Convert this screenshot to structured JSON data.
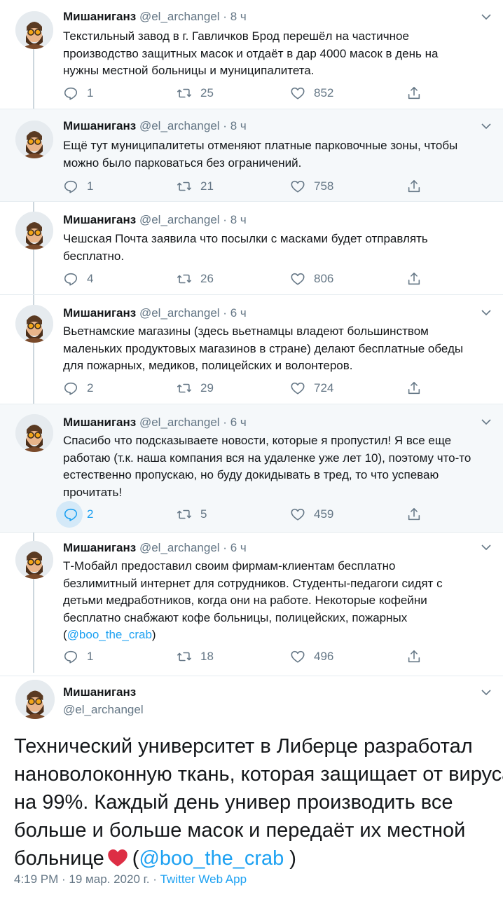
{
  "author": {
    "name": "Мишаниганз",
    "handle": "@el_archangel",
    "sep": "·"
  },
  "tweets": [
    {
      "time": "8 ч",
      "lines": [
        "Текстильный завод в г. Гавличков Брод перешёл на частичное",
        "производство защитных масок и отдаёт в дар 4000 масок в день на",
        "нужны местной больницы и муниципалитета."
      ],
      "replies": "1",
      "retweets": "25",
      "likes": "852"
    },
    {
      "time": "8 ч",
      "lines": [
        "Ещё тут муниципалитеты отменяют платные парковочные зоны, чтобы",
        "можно было парковаться без ограничений."
      ],
      "replies": "1",
      "retweets": "21",
      "likes": "758"
    },
    {
      "time": "8 ч",
      "lines": [
        "Чешская Почта заявила что посылки с масками будет отправлять",
        "бесплатно."
      ],
      "replies": "4",
      "retweets": "26",
      "likes": "806"
    },
    {
      "time": "6 ч",
      "lines": [
        "Вьетнамские магазины (здесь вьетнамцы владеют большинством",
        "маленьких продуктовых магазинов в стране) делают бесплатные обеды",
        "для пожарных, медиков, полицейских и волонтеров."
      ],
      "replies": "2",
      "retweets": "29",
      "likes": "724"
    },
    {
      "time": "6 ч",
      "lines": [
        "Спасибо что подсказываете новости, которые я пропустил!  Я все еще",
        "работаю (т.к. наша компания вся на удаленке уже лет 10), поэтому что-то",
        "естественно пропускаю, но буду докидывать в тред, то что успеваю",
        "прочитать!"
      ],
      "replies": "2",
      "retweets": "5",
      "likes": "459"
    },
    {
      "time": "6 ч",
      "lines": [
        "Т-Мобайл предоставил своим фирмам-клиентам бесплатно",
        "безлимитный интернет для сотрудников. Студенты-педагоги сидят с",
        "детьми медработников, когда они на работе. Некоторые кофейни",
        "бесплатно снабжают кофе больницы, полицейских, пожарных"
      ],
      "mention_line": {
        "open": "(",
        "mention": "@boo_the_crab",
        "close": ")"
      },
      "replies": "1",
      "retweets": "18",
      "likes": "496"
    }
  ],
  "main_tweet": {
    "lines": [
      "Технический университет в Либерце разработал",
      "нановолоконную ткань, которая защищает от вируса",
      "на 99%. Каждый день универ производить все",
      "больше и больше масок и передаёт их местной"
    ],
    "last_line_start": "больнице",
    "last_line_open": "(",
    "mention": "@boo_the_crab",
    "last_line_close": " )",
    "timestamp": "4:19 PM · 19 мар. 2020 г. · ",
    "source": "Twitter Web App"
  },
  "colors": {
    "link": "#1da1f2",
    "muted": "#657786",
    "shaded_bg": "#f5f8fa",
    "heart": "#dd2e44"
  }
}
